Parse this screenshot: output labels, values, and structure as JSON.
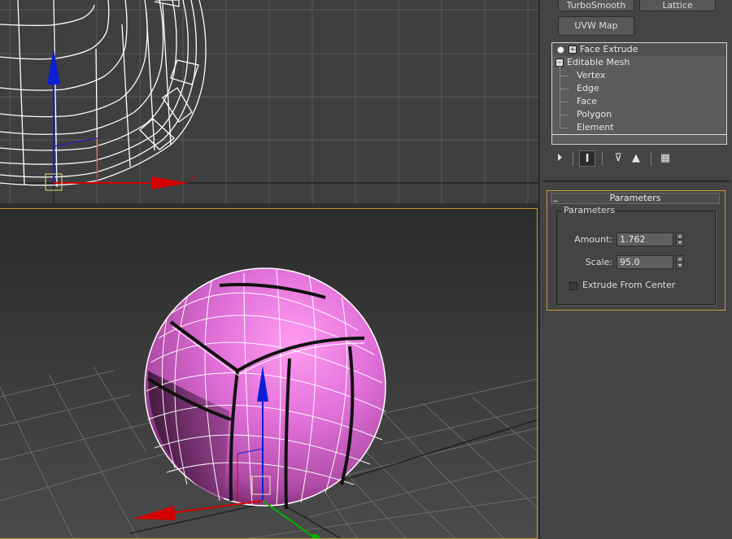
{
  "modifier_buttons": {
    "turbosmooth": "TurboSmooth",
    "lattice": "Lattice",
    "uvw_map": "UVW Map"
  },
  "modifier_stack": {
    "items": [
      {
        "label": "Face Extrude",
        "icons": [
          "lightbulb-icon",
          "expand-plus-icon"
        ]
      },
      {
        "label": "Editable Mesh",
        "expanded": true
      },
      {
        "label": "Vertex"
      },
      {
        "label": "Edge"
      },
      {
        "label": "Face"
      },
      {
        "label": "Polygon"
      },
      {
        "label": "Element"
      }
    ]
  },
  "stack_toolbar": {
    "icons": [
      "pin-stack-icon",
      "show-end-result-icon",
      "make-unique-icon",
      "remove-modifier-icon",
      "configure-modifier-sets-icon"
    ]
  },
  "parameters": {
    "rollout_title": "Parameters",
    "collapse_symbol": "_",
    "group_title": "Parameters",
    "amount_label": "Amount:",
    "amount_value": "1.762",
    "scale_label": "Scale:",
    "scale_value": "95.0",
    "extrude_from_center_label": "Extrude From Center",
    "extrude_from_center_checked": false
  },
  "viewports": {
    "top": {
      "view": "front",
      "object": "volleyball-wireframe"
    },
    "bottom": {
      "view": "perspective",
      "active": true,
      "object": "volleyball-shaded",
      "object_color": "#e070d8"
    }
  },
  "colors": {
    "active_viewport_border": "#c99a35",
    "gizmo_z": "#0a1fd6",
    "gizmo_x": "#d40000",
    "gizmo_y": "#00b000",
    "wireframe": "#ffffff"
  }
}
